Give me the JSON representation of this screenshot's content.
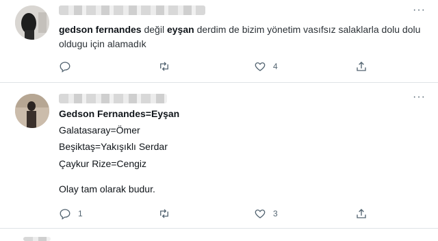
{
  "tweets": [
    {
      "author_blurred": true,
      "body_parts": {
        "part1": "gedson fernandes",
        "part2": "değil",
        "part3": "eyşan",
        "part4": "derdim de bizim yönetim vasıfsız salaklarla dolu dolu oldugu için alamadık"
      },
      "actions": {
        "reply_count": "",
        "retweet_count": "",
        "like_count": "4"
      }
    },
    {
      "author_blurred": true,
      "title": "Gedson Fernandes=Eyşan",
      "lines": [
        "Galatasaray=Ömer",
        "Beşiktaş=Yakışıklı Serdar",
        "Çaykur Rize=Cengiz",
        "Olay tam olarak budur."
      ],
      "actions": {
        "reply_count": "1",
        "retweet_count": "",
        "like_count": "3"
      }
    }
  ],
  "colors": {
    "text": "#0f1419",
    "secondary": "#536471",
    "divider": "#dfe3e6"
  },
  "icons": [
    "more-icon",
    "reply-icon",
    "retweet-icon",
    "like-icon",
    "share-icon"
  ]
}
